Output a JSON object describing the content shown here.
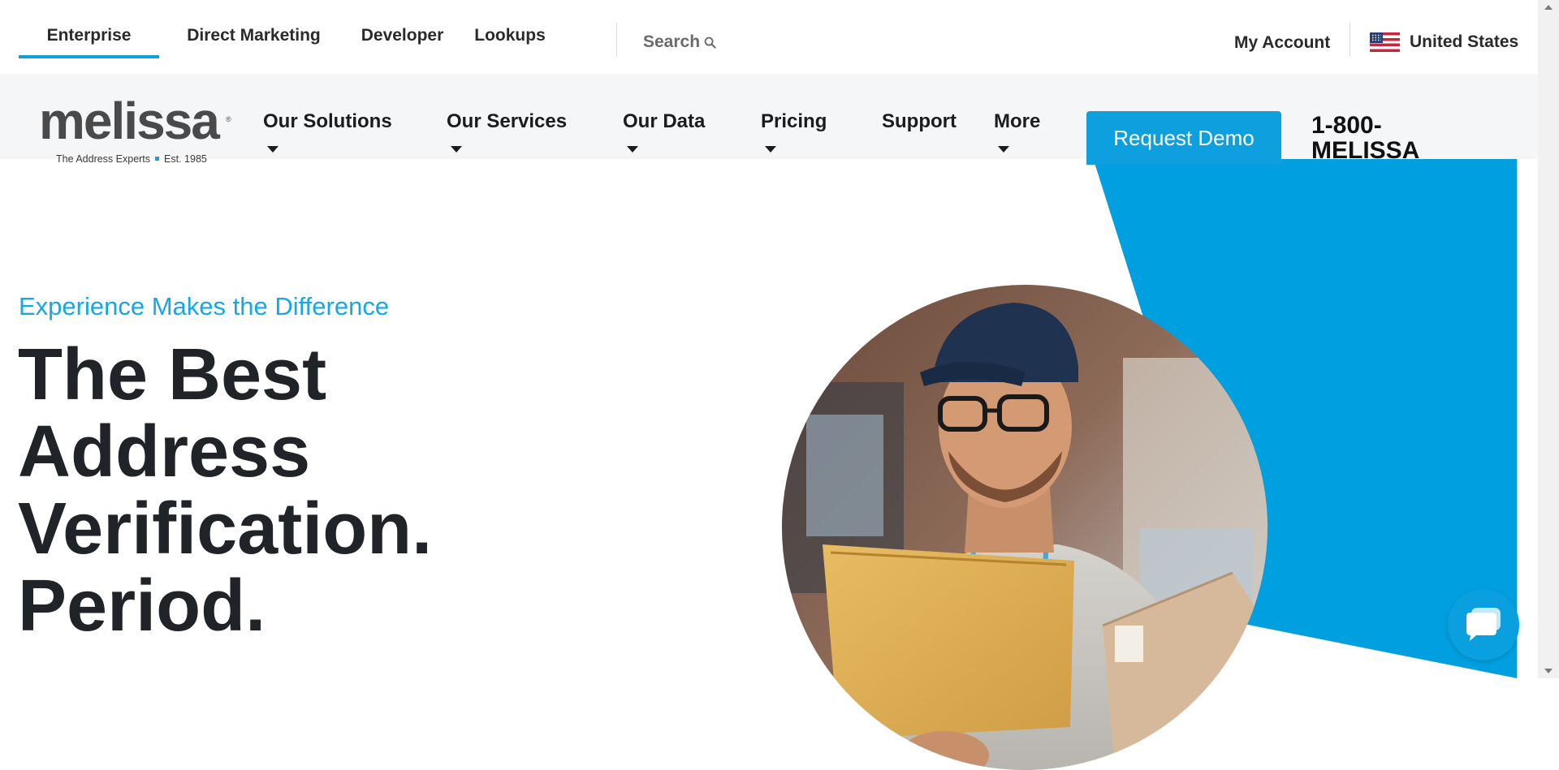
{
  "topbar": {
    "tabs": [
      {
        "label": "Enterprise",
        "active": true
      },
      {
        "label": "Direct Marketing"
      },
      {
        "label": "Developer"
      },
      {
        "label": "Lookups"
      }
    ],
    "search_label": "Search",
    "my_account": "My Account",
    "country": "United States"
  },
  "logo": {
    "word": "melissa",
    "reg": "®",
    "tagline_left": "The Address Experts",
    "tagline_right": "Est. 1985"
  },
  "mainnav": {
    "items": [
      {
        "label": "Our Solutions",
        "dropdown": true
      },
      {
        "label": "Our Services",
        "dropdown": true
      },
      {
        "label": "Our Data",
        "dropdown": true
      },
      {
        "label": "Pricing",
        "dropdown": true
      },
      {
        "label": "Support",
        "dropdown": false
      },
      {
        "label": "More",
        "dropdown": true
      }
    ],
    "cta": "Request Demo",
    "phone": "1-800-MELISSA"
  },
  "hero": {
    "eyebrow": "Experience Makes the Difference",
    "headline_lines": [
      "The Best",
      "Address",
      "Verification.",
      "Period."
    ]
  },
  "colors": {
    "accent": "#0ea0de",
    "headline": "#202328",
    "nav_bg": "#f5f6f8"
  },
  "icons": {
    "search": "search-icon",
    "flag": "us-flag-icon",
    "chat": "chat-bubble-icon"
  }
}
